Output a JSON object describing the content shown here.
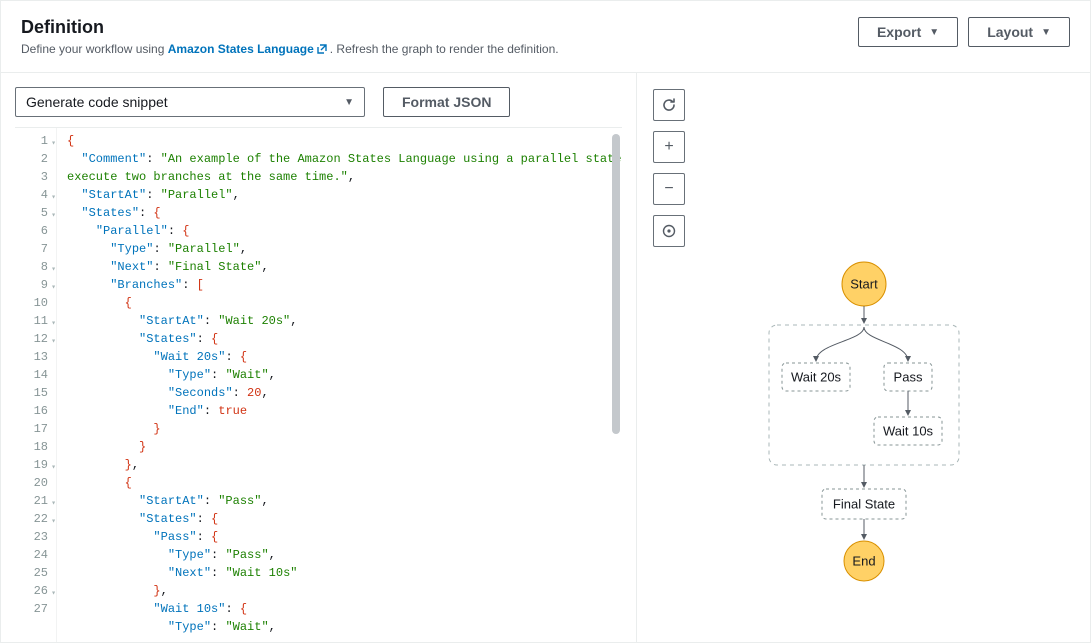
{
  "header": {
    "title": "Definition",
    "subtitle_prefix": "Define your workflow using ",
    "subtitle_link": "Amazon States Language",
    "subtitle_suffix": ". Refresh the graph to render the definition.",
    "export_label": "Export",
    "layout_label": "Layout"
  },
  "toolbar": {
    "snippet_label": "Generate code snippet",
    "format_label": "Format JSON"
  },
  "graph": {
    "start": "Start",
    "end": "End",
    "wait20": "Wait 20s",
    "pass": "Pass",
    "wait10": "Wait 10s",
    "final": "Final State"
  },
  "controls": {
    "refresh": "refresh",
    "zoom_in": "+",
    "zoom_out": "−",
    "center": "center"
  },
  "editor": {
    "lines": [
      {
        "n": "1",
        "fold": true
      },
      {
        "n": "2",
        "fold": false
      },
      {
        "n": "3",
        "fold": false
      },
      {
        "n": "4",
        "fold": true
      },
      {
        "n": "5",
        "fold": true
      },
      {
        "n": "6",
        "fold": false
      },
      {
        "n": "7",
        "fold": false
      },
      {
        "n": "8",
        "fold": true
      },
      {
        "n": "9",
        "fold": true
      },
      {
        "n": "10",
        "fold": false
      },
      {
        "n": "11",
        "fold": true
      },
      {
        "n": "12",
        "fold": true
      },
      {
        "n": "13",
        "fold": false
      },
      {
        "n": "14",
        "fold": false
      },
      {
        "n": "15",
        "fold": false
      },
      {
        "n": "16",
        "fold": false
      },
      {
        "n": "17",
        "fold": false
      },
      {
        "n": "18",
        "fold": false
      },
      {
        "n": "19",
        "fold": true
      },
      {
        "n": "20",
        "fold": false
      },
      {
        "n": "21",
        "fold": true
      },
      {
        "n": "22",
        "fold": true
      },
      {
        "n": "23",
        "fold": false
      },
      {
        "n": "24",
        "fold": false
      },
      {
        "n": "25",
        "fold": false
      },
      {
        "n": "26",
        "fold": true
      },
      {
        "n": "27",
        "fold": false
      }
    ]
  },
  "code": {
    "line1": "{",
    "comment_key": "\"Comment\"",
    "comment_val": "\"An example of the Amazon States Language using a parallel state to \nexecute two branches at the same time.\"",
    "startat_key": "\"StartAt\"",
    "startat_val": "\"Parallel\"",
    "states_key": "\"States\"",
    "parallel_key": "\"Parallel\"",
    "type_key": "\"Type\"",
    "type_parallel": "\"Parallel\"",
    "next_key": "\"Next\"",
    "next_final": "\"Final State\"",
    "branches_key": "\"Branches\"",
    "wait20_val": "\"Wait 20s\"",
    "wait20_key": "\"Wait 20s\"",
    "type_wait": "\"Wait\"",
    "seconds_key": "\"Seconds\"",
    "seconds_20": "20",
    "end_key": "\"End\"",
    "end_true": "true",
    "pass_val": "\"Pass\"",
    "pass_key": "\"Pass\"",
    "type_pass": "\"Pass\"",
    "next_wait10": "\"Wait 10s\"",
    "wait10_key": "\"Wait 10s\""
  }
}
